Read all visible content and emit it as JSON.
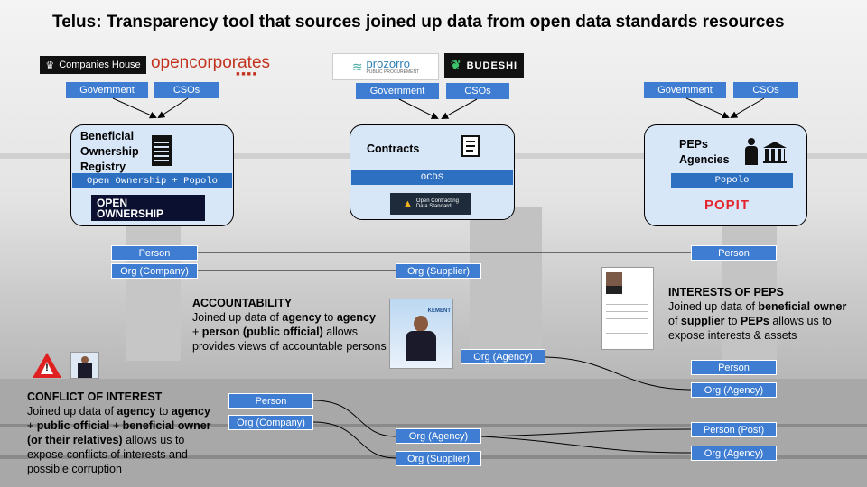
{
  "title": "Telus: Transparency tool that sources joined up data from open data standards resources",
  "logos": {
    "companies_house": "Companies House",
    "opencorporates": "opencorporates",
    "prozorro": "prozorro",
    "prozorro_sub": "PUBLIC PROCUREMENT",
    "budeshi": "BUDESHI",
    "open_ownership_1": "OPEN",
    "open_ownership_2": "OWNERSHIP",
    "ocds_1": "Open Contracting",
    "ocds_2": "Data Standard",
    "popit": "POPIT"
  },
  "sources": {
    "government": "Government",
    "csos": "CSOs"
  },
  "cards": {
    "bo": {
      "title_1": "Beneficial",
      "title_2": "Ownership",
      "title_3": "Registry",
      "standard": "Open Ownership + Popolo"
    },
    "contracts": {
      "title": "Contracts",
      "standard": "OCDS"
    },
    "peps": {
      "title_1": "PEPs",
      "title_2": "Agencies",
      "standard": "Popolo"
    }
  },
  "nodes": {
    "person": "Person",
    "org_company": "Org (Company)",
    "org_supplier": "Org (Supplier)",
    "org_agency": "Org (Agency)",
    "person_post": "Person (Post)"
  },
  "accountability": {
    "title": "ACCOUNTABILITY",
    "t1": "Joined up data of ",
    "b1": "agency",
    "t2": " to ",
    "b2": "agency",
    "t3": "+ ",
    "b3": "person (public official)",
    "t4": " allows provides views of accountable persons"
  },
  "interests": {
    "title": "INTERESTS OF PEPS",
    "t1": "Joined up data of ",
    "b1": "beneficial owner",
    "t2": "of ",
    "b2": "supplier",
    "t3": " to ",
    "b3": "PEPs",
    "t4": " allows us to expose interests & assets"
  },
  "conflict": {
    "title": "CONFLICT OF INTEREST",
    "t1": "Joined up data of ",
    "b1": "agency",
    "t2": " to ",
    "b2": "agency",
    "t3": "+ ",
    "b3": "public official",
    "t4": " + ",
    "b4": "beneficial owner",
    "t5": "  (or their relatives)",
    "t6": " allows us to expose conflicts of interests and possible corruption"
  },
  "photo_caption": "KEMENT",
  "colors": {
    "node_blue": "#3f7dd2",
    "card_fill": "#d7e7f8",
    "std_blue": "#2d6fc0"
  }
}
